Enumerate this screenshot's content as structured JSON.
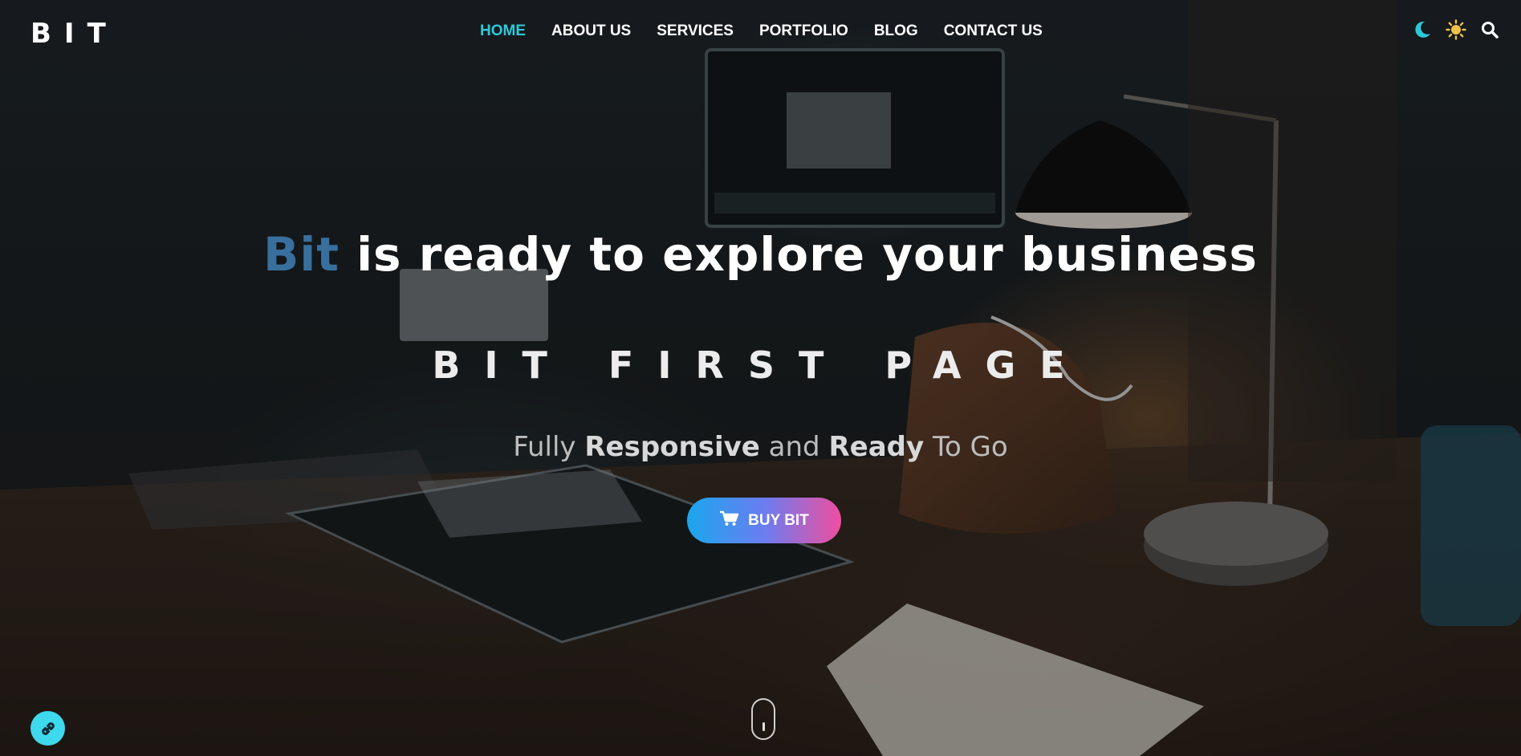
{
  "brand": {
    "logo_text": "BIT"
  },
  "nav": {
    "items": [
      {
        "label": "HOME",
        "active": true
      },
      {
        "label": "ABOUT US",
        "active": false
      },
      {
        "label": "SERVICES",
        "active": false
      },
      {
        "label": "PORTFOLIO",
        "active": false
      },
      {
        "label": "BLOG",
        "active": false
      },
      {
        "label": "CONTACT US",
        "active": false
      }
    ],
    "active_color": "#2cc9d8"
  },
  "tools": {
    "icons": [
      "moon-icon",
      "sun-icon",
      "search-icon"
    ],
    "moon_color": "#2cc9d8",
    "sun_color": "#f0c246"
  },
  "hero": {
    "headline_brand": "Bit",
    "headline_rest": "is ready to explore your business",
    "subtitle": "BIT FIRST PAGE",
    "tagline": {
      "part1": "Fully",
      "bold1": "Responsive",
      "part2": "and",
      "bold2": "Ready",
      "part3": "To Go"
    },
    "cta_label": "BUY BIT",
    "cta_icon": "cart-icon"
  },
  "floating": {
    "icon": "link-icon",
    "color": "#3ed9ec"
  },
  "scroll_indicator": {
    "icon": "mouse-scroll-icon"
  }
}
